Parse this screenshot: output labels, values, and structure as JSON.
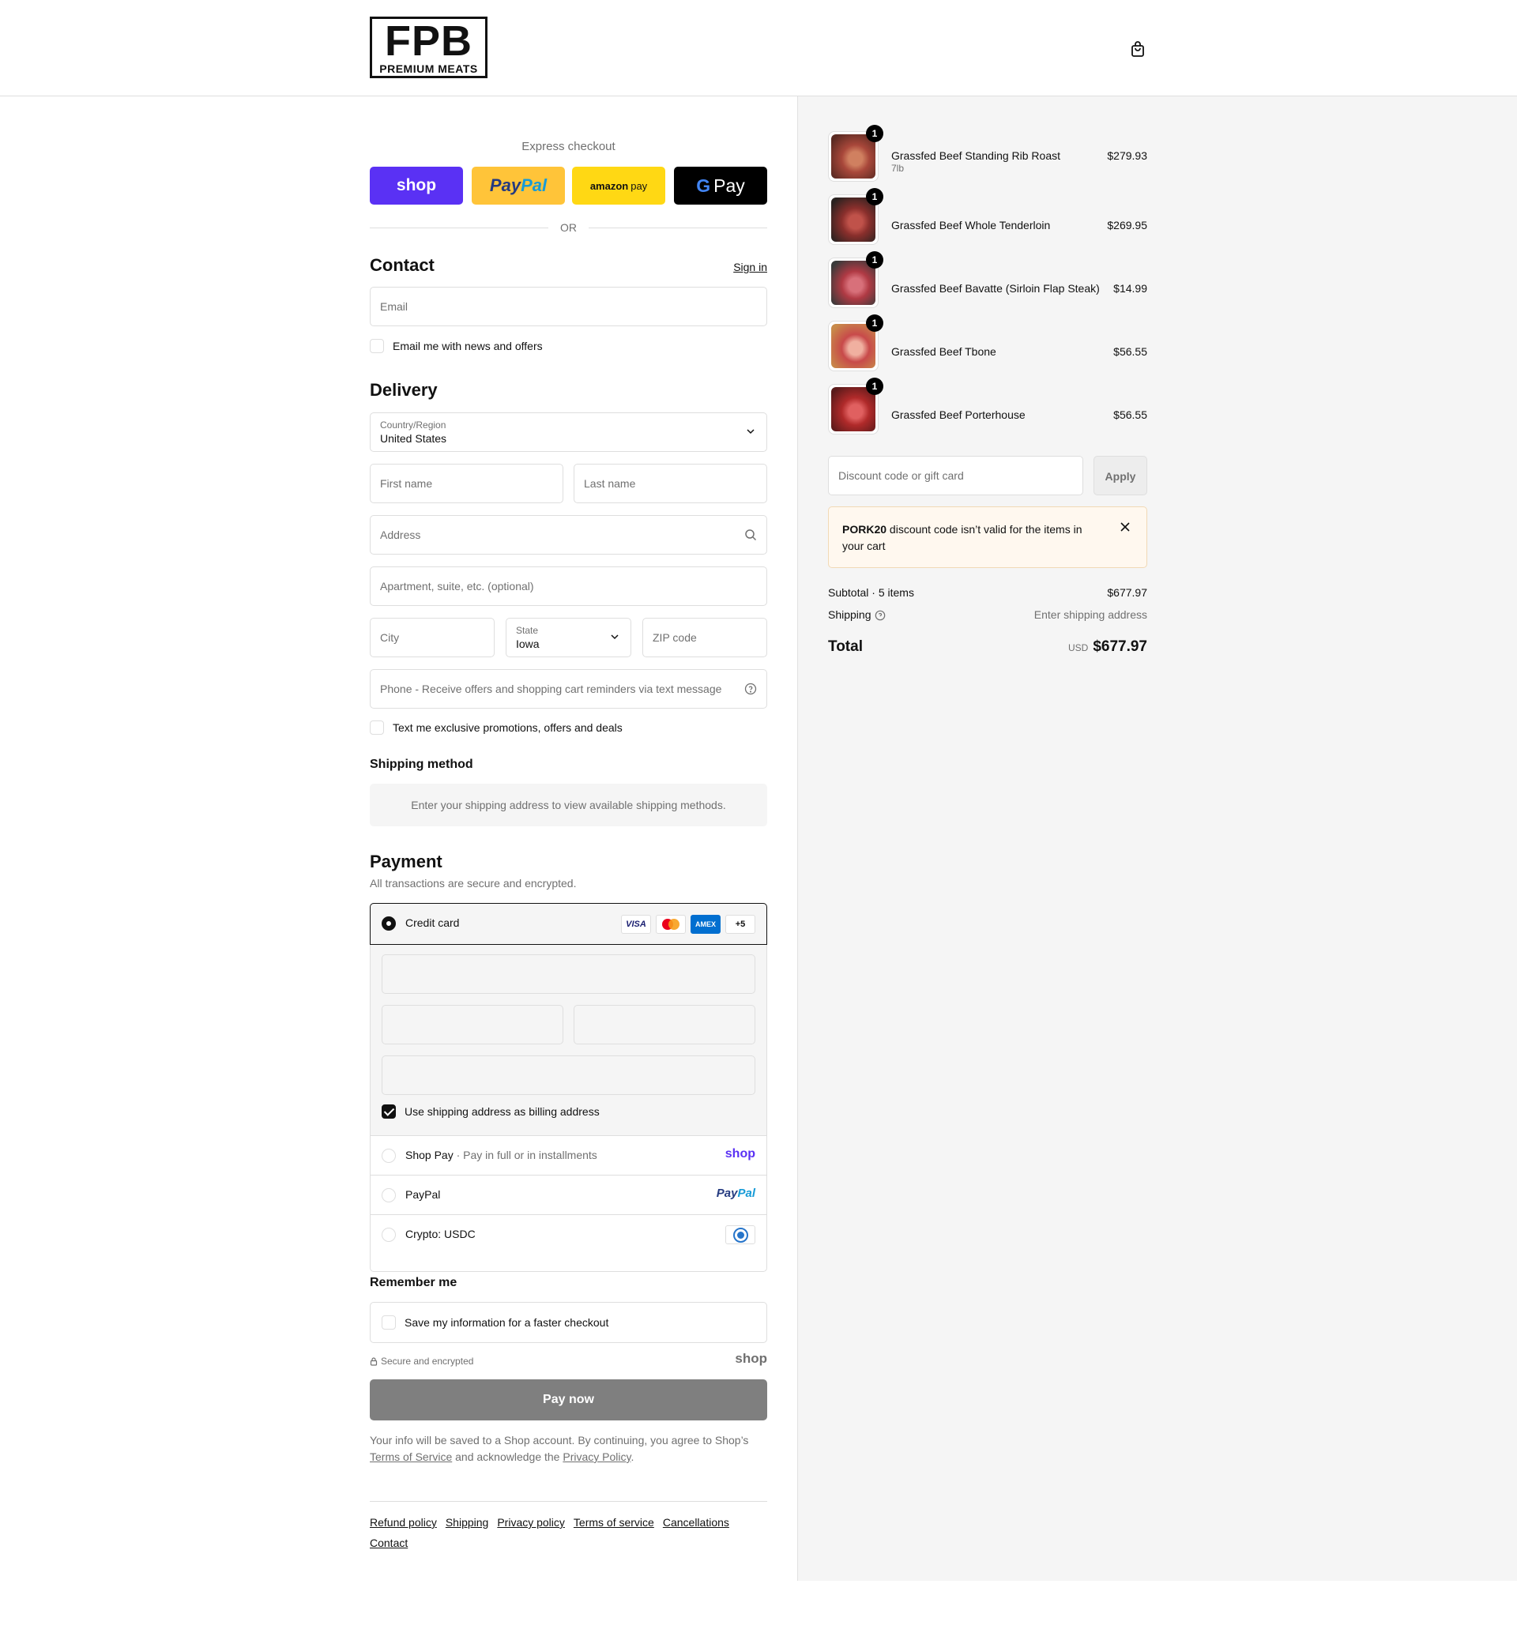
{
  "brand": {
    "logo_main": "FPB",
    "logo_sub": "PREMIUM MEATS"
  },
  "express": {
    "label": "Express checkout",
    "shop": "shop",
    "paypal_a": "Pay",
    "paypal_b": "Pal",
    "amazon_a": "amazon",
    "amazon_b": "pay",
    "gpay_g": "G",
    "gpay_pay": "Pay",
    "or": "OR"
  },
  "contact": {
    "title": "Contact",
    "sign_in": "Sign in",
    "email_placeholder": "Email",
    "news_label": "Email me with news and offers"
  },
  "delivery": {
    "title": "Delivery",
    "country_label": "Country/Region",
    "country_value": "United States",
    "first_name": "First name",
    "last_name": "Last name",
    "address": "Address",
    "apartment": "Apartment, suite, etc. (optional)",
    "city": "City",
    "state_label": "State",
    "state_value": "Iowa",
    "zip": "ZIP code",
    "phone": "Phone - Receive offers and shopping cart reminders via text message",
    "text_label": "Text me exclusive promotions, offers and deals"
  },
  "shipping_method": {
    "title": "Shipping method",
    "message": "Enter your shipping address to view available shipping methods."
  },
  "payment": {
    "title": "Payment",
    "subtitle": "All transactions are secure and encrypted.",
    "credit_card": "Credit card",
    "cards": [
      "VISA",
      "AMEX",
      "+5"
    ],
    "billing_label": "Use shipping address as billing address",
    "shop_pay": "Shop Pay",
    "shop_pay_desc": "Pay in full or in installments",
    "shop_pay_logo": "shop",
    "paypal": "PayPal",
    "paypal_logo_a": "Pay",
    "paypal_logo_b": "Pal",
    "crypto": "Crypto: USDC"
  },
  "remember": {
    "title": "Remember me",
    "save_label": "Save my information for a faster checkout",
    "secure": "Secure and encrypted",
    "shop_logo": "shop"
  },
  "pay_now": "Pay now",
  "legal": {
    "line1": "Your info will be saved to a Shop account. By continuing, you agree to Shop’s",
    "terms": "Terms of Service",
    "mid": "and acknowledge the",
    "privacy": "Privacy Policy",
    "end": "."
  },
  "footer": [
    "Refund policy",
    "Shipping",
    "Privacy policy",
    "Terms of service",
    "Cancellations",
    "Contact"
  ],
  "cart": {
    "items": [
      {
        "name": "Grassfed Beef Standing Rib Roast",
        "variant": "7lb",
        "price": "$279.93",
        "qty": "1",
        "colors": [
          "#5a2a22",
          "#a8473a",
          "#d08060"
        ]
      },
      {
        "name": "Grassfed Beef Whole Tenderloin",
        "variant": "",
        "price": "$269.95",
        "qty": "1",
        "colors": [
          "#2a2220",
          "#8a2f2c",
          "#c0524a"
        ]
      },
      {
        "name": "Grassfed Beef Bavatte (Sirloin Flap Steak)",
        "variant": "",
        "price": "$14.99",
        "qty": "1",
        "colors": [
          "#3a3a3a",
          "#b03a44",
          "#d8707a"
        ]
      },
      {
        "name": "Grassfed Beef Tbone",
        "variant": "",
        "price": "$56.55",
        "qty": "1",
        "colors": [
          "#c88a4a",
          "#c84a4a",
          "#f0b0a0"
        ]
      },
      {
        "name": "Grassfed Beef Porterhouse",
        "variant": "",
        "price": "$56.55",
        "qty": "1",
        "colors": [
          "#5a1a1a",
          "#b02a2a",
          "#e06060"
        ]
      }
    ],
    "discount_placeholder": "Discount code or gift card",
    "apply": "Apply",
    "alert_code": "PORK20",
    "alert_text": "discount code isn’t valid for the items in your cart",
    "subtotal_label": "Subtotal · 5 items",
    "subtotal": "$677.97",
    "shipping_label": "Shipping",
    "shipping_value": "Enter shipping address",
    "total_label": "Total",
    "currency": "USD",
    "total": "$677.97"
  }
}
